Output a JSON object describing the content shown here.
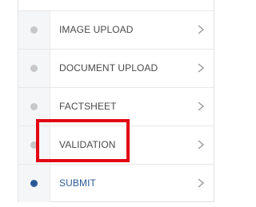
{
  "steps": [
    {
      "label": "IMAGE UPLOAD",
      "status": "inactive",
      "icon": "chevron-right-icon"
    },
    {
      "label": "DOCUMENT UPLOAD",
      "status": "inactive",
      "icon": "chevron-right-icon"
    },
    {
      "label": "FACTSHEET",
      "status": "inactive",
      "icon": "chevron-right-icon"
    },
    {
      "label": "VALIDATION",
      "status": "inactive",
      "icon": "chevron-right-icon"
    },
    {
      "label": "SUBMIT",
      "status": "active",
      "icon": "chevron-right-icon"
    }
  ],
  "colors": {
    "inactive_dot": "#c8c8c8",
    "active_dot": "#2a5a96",
    "text": "#4a4a4a",
    "active_text": "#2a5a96",
    "highlight_border": "#e30613",
    "chevron": "#9a9a9a"
  },
  "annotation": {
    "highlighted_step": "VALIDATION"
  }
}
